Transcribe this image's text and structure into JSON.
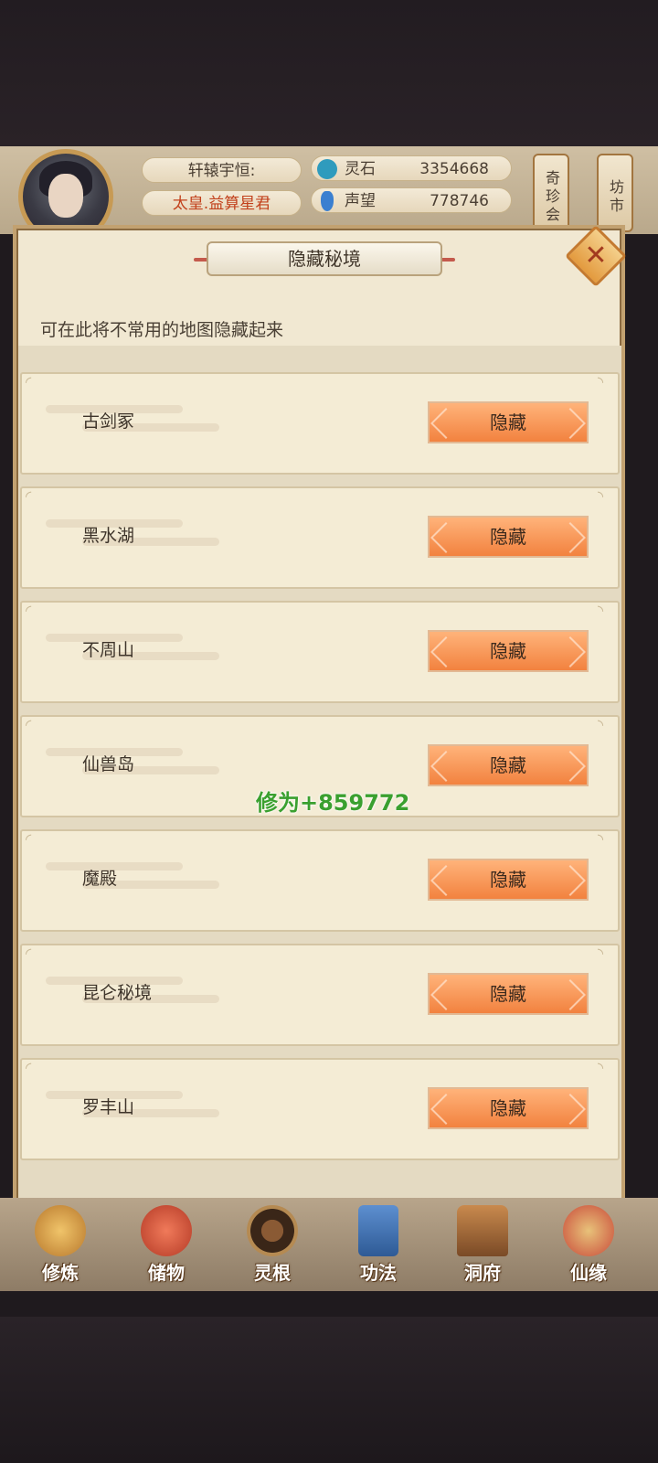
{
  "hud": {
    "player_name": "轩辕宇恒:",
    "player_title": "太皇.益算星君",
    "resources": [
      {
        "label": "灵石",
        "value": "3354668",
        "icon": "spirit-stone-icon",
        "color": "#2f9bbd"
      },
      {
        "label": "声望",
        "value": "778746",
        "icon": "prestige-icon",
        "color": "#3a7fd0"
      }
    ],
    "side_buttons": [
      {
        "label": "奇珍会"
      },
      {
        "label": "坊市"
      }
    ]
  },
  "dialog": {
    "title": "隐藏秘境",
    "subtitle": "可在此将不常用的地图隐藏起来",
    "close_icon": "close-icon",
    "rows": [
      {
        "name": "古剑冢",
        "button": "隐藏"
      },
      {
        "name": "黑水湖",
        "button": "隐藏"
      },
      {
        "name": "不周山",
        "button": "隐藏"
      },
      {
        "name": "仙兽岛",
        "button": "隐藏"
      },
      {
        "name": "魔殿",
        "button": "隐藏"
      },
      {
        "name": "昆仑秘境",
        "button": "隐藏"
      },
      {
        "name": "罗丰山",
        "button": "隐藏"
      }
    ]
  },
  "floating_text": "修为+859772",
  "nav": {
    "items": [
      {
        "label": "修炼",
        "icon": "cultivate-icon",
        "color": "#d8a14a"
      },
      {
        "label": "储物",
        "icon": "storage-bag-icon",
        "color": "#d4543c"
      },
      {
        "label": "灵根",
        "icon": "spirit-root-icon",
        "color": "#5a3a24"
      },
      {
        "label": "功法",
        "icon": "technique-book-icon",
        "color": "#3f6fb0"
      },
      {
        "label": "洞府",
        "icon": "cave-abode-icon",
        "color": "#a0683c"
      },
      {
        "label": "仙缘",
        "icon": "gourd-icon",
        "color": "#c94a3a"
      }
    ]
  },
  "colors": {
    "accent_button": "#f2823f",
    "title_red": "#c2411c",
    "float_green": "#3aa02f"
  }
}
